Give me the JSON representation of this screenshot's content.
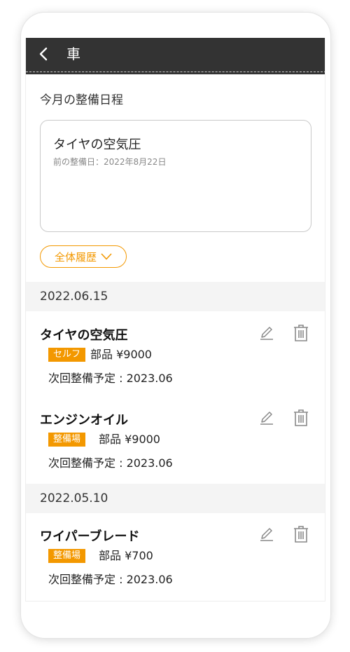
{
  "header": {
    "title": "車",
    "back_icon": "chevron-left-icon"
  },
  "schedule": {
    "section_title": "今月の整備日程",
    "card": {
      "name": "タイヤの空気圧",
      "prev_date": "前の整備日：2022年8月22日"
    }
  },
  "history_button": {
    "label": "全体履歴",
    "icon": "chevron-down-icon"
  },
  "groups": [
    {
      "date": "2022.06.15",
      "items": [
        {
          "name": "タイヤの空気圧",
          "badge": "セルフ",
          "price": "部品 ¥9000",
          "next": "次回整備予定 : 2023.06"
        },
        {
          "name": "エンジンオイル",
          "badge": "整備場",
          "price": "部品 ¥9000",
          "next": "次回整備予定 : 2023.06"
        }
      ]
    },
    {
      "date": "2022.05.10",
      "items": [
        {
          "name": "ワイパーブレード",
          "badge": "整備場",
          "price": "部品 ¥700",
          "next": "次回整備予定 : 2023.06"
        }
      ]
    }
  ],
  "colors": {
    "accent": "#f39800",
    "header_bg": "#333333",
    "date_bar_bg": "#f4f4f4"
  }
}
